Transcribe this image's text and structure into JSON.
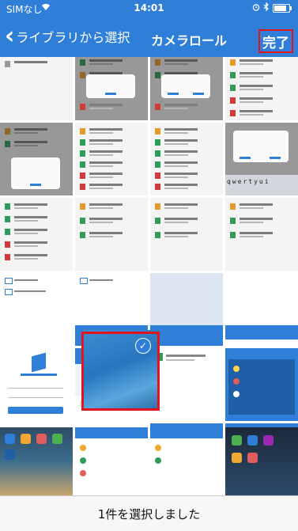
{
  "status_bar": {
    "carrier": "SIMなし",
    "time": "14:01"
  },
  "nav": {
    "back_label": "ライブラリから選択",
    "title": "カメラロール",
    "done_label": "完了"
  },
  "grid": {
    "photo_count": 24,
    "selected_count": 1
  },
  "footer": {
    "selection_text": "1件を選択しました"
  },
  "colors": {
    "accent": "#2f7fd9",
    "highlight": "#e2141d"
  }
}
